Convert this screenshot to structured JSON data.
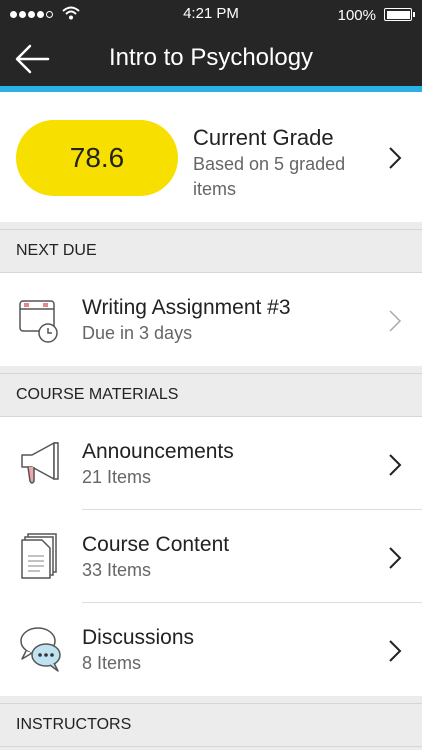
{
  "status": {
    "time": "4:21 PM",
    "battery": "100%"
  },
  "nav": {
    "title": "Intro to Psychology"
  },
  "grade": {
    "value": "78.6",
    "title": "Current Grade",
    "subtitle": "Based on 5 graded items"
  },
  "sections": {
    "next_due": "NEXT DUE",
    "course_materials": "COURSE MATERIALS",
    "instructors": "INSTRUCTORS"
  },
  "next_due": {
    "title": "Writing Assignment #3",
    "due": "Due in 3 days"
  },
  "materials": [
    {
      "title": "Announcements",
      "count": "21 Items",
      "icon": "megaphone-icon"
    },
    {
      "title": "Course Content",
      "count": "33 Items",
      "icon": "document-stack-icon"
    },
    {
      "title": "Discussions",
      "count": "8 Items",
      "icon": "chat-bubbles-icon"
    }
  ],
  "colors": {
    "accent": "#2bb1e3",
    "grade_pill": "#f7df00",
    "bar": "#262626"
  }
}
